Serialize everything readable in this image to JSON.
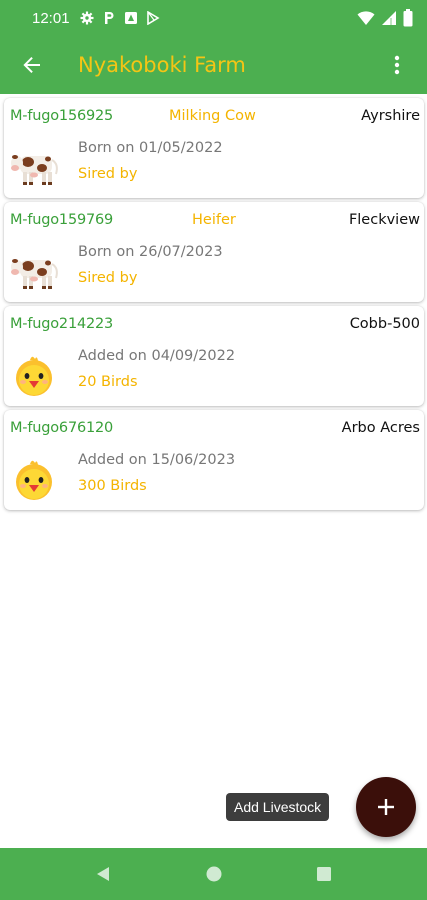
{
  "status_bar": {
    "time": "12:01",
    "left_icons": [
      "gear-icon",
      "parking-icon",
      "play-store-notify-icon",
      "play-icon"
    ],
    "right_icons": [
      "wifi-icon",
      "signal-icon",
      "battery-icon"
    ]
  },
  "app_bar": {
    "title": "Nyakoboki Farm",
    "back_icon": "arrow-left-icon",
    "menu_icon": "more-vert-icon"
  },
  "livestock": [
    {
      "tag": "M-fugo156925",
      "type": "Milking Cow",
      "breed": "Ayrshire",
      "date_text": "Born on 01/05/2022",
      "sub_text": "Sired by",
      "animal": "cow"
    },
    {
      "tag": "M-fugo159769",
      "type": "Heifer",
      "breed": "Fleckview",
      "date_text": "Born on 26/07/2023",
      "sub_text": "Sired by",
      "animal": "cow"
    },
    {
      "tag": "M-fugo214223",
      "type": "",
      "breed": "Cobb-500",
      "date_text": "Added on 04/09/2022",
      "sub_text": "20 Birds",
      "animal": "chick"
    },
    {
      "tag": "M-fugo676120",
      "type": "",
      "breed": "Arbo Acres",
      "date_text": "Added on 15/06/2023",
      "sub_text": "300 Birds",
      "animal": "chick"
    }
  ],
  "fab": {
    "tooltip": "Add Livestock",
    "icon": "plus-icon"
  },
  "nav_bar": {
    "buttons": [
      "back-triangle-icon",
      "home-circle-icon",
      "recents-square-icon"
    ]
  },
  "colors": {
    "primary": "#4caf50",
    "title": "#f4c515",
    "tag": "#3aa03a",
    "accent": "#f4b400",
    "fab": "#3b0f0a"
  }
}
